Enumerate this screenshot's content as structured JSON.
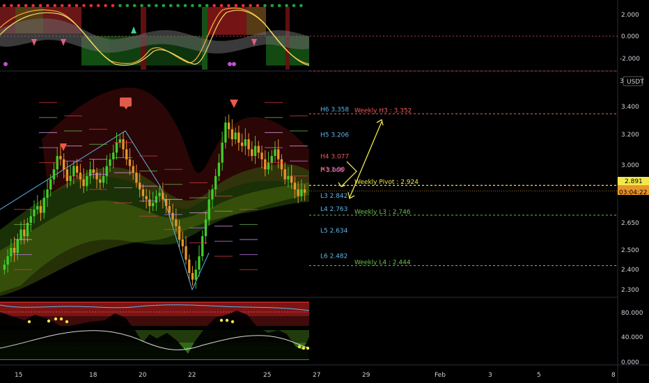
{
  "chart_data": [
    {
      "type": "oscillator",
      "pane": "top",
      "y_ticks": [
        "2.000",
        "0.000",
        "-2.000"
      ],
      "ylim": [
        -3,
        3
      ]
    },
    {
      "type": "candlestick",
      "pane": "main",
      "currency_badge": "USDT",
      "y_ticks": [
        "3.400",
        "3.200",
        "3.000",
        "2.650",
        "2.500",
        "2.400",
        "2.300"
      ],
      "ylim": [
        2.28,
        3.52
      ],
      "last_price": "2.891",
      "countdown": "03:04:22",
      "zigzag": [
        [
          2.78,
          2.72
        ],
        [
          2.95,
          2.64
        ],
        [
          3.13,
          3.25
        ],
        [
          3.03,
          2.92
        ],
        [
          2.68,
          2.33
        ],
        [
          2.3,
          2.61
        ]
      ],
      "levels": [
        {
          "label": "H6 3.358",
          "value": 3.358,
          "color": "#5fb6e8"
        },
        {
          "label": "Weekly H3 : 3.352",
          "value": 3.352,
          "color": "#f05a5a"
        },
        {
          "label": "H5 3.206",
          "value": 3.206,
          "color": "#5fb6e8"
        },
        {
          "label": "H4 3.077",
          "value": 3.077,
          "color": "#f05a5a"
        },
        {
          "label": "H3 3.00",
          "value": 3.0,
          "color": "#f05a5a"
        },
        {
          "label": "P 3.008",
          "value": 2.995,
          "color": "#c27bf0"
        },
        {
          "label": "Weekly Pivot : 2.924",
          "value": 2.924,
          "color": "#f2e84a"
        },
        {
          "label": "L3 2.842",
          "value": 2.842,
          "color": "#5fb6e8"
        },
        {
          "label": "L4 2.763",
          "value": 2.763,
          "color": "#5fb6e8"
        },
        {
          "label": "Weekly L3 : 2.746",
          "value": 2.746,
          "color": "#6cc04a"
        },
        {
          "label": "L5 2.634",
          "value": 2.634,
          "color": "#5fb6e8"
        },
        {
          "label": "L6 2.482",
          "value": 2.482,
          "color": "#5fb6e8"
        },
        {
          "label": "Weekly L4 : 2.444",
          "value": 2.444,
          "color": "#6cc04a"
        }
      ],
      "projection_arrows": "double-headed yellow arrows between 2.76 and 3.34"
    },
    {
      "type": "oscillator",
      "pane": "bottom",
      "y_ticks": [
        "80.000",
        "40.000",
        "0.000"
      ],
      "ylim": [
        0,
        100
      ]
    }
  ],
  "x_axis": {
    "tick_labels": [
      "15",
      "18",
      "20",
      "22",
      "25",
      "27",
      "29",
      "Feb",
      "3",
      "5",
      "8"
    ]
  },
  "colors": {
    "background": "#000000",
    "bull": "#3fcf2a",
    "bear": "#e8962a",
    "signal_down": "#f0594b",
    "signal_up": "#3fcf77",
    "pivot": "#f2e84a"
  }
}
